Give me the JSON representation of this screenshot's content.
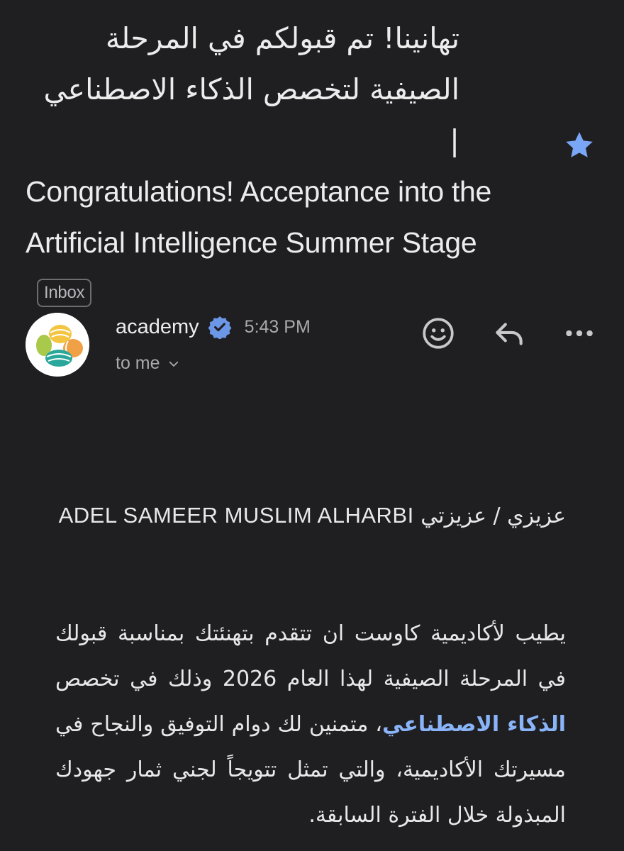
{
  "email": {
    "subject_ar": "تهانينا! تم قبولكم في المرحلة الصيفية لتخصص الذكاء الاصطناعي |",
    "subject_en": "Congratulations! Acceptance into the Artificial Intelligence Summer Stage",
    "label": "Inbox",
    "starred": true,
    "sender_name": "academy",
    "time": "5:43 PM",
    "recipient": "to me"
  },
  "body": {
    "greeting_prefix": "عزيزي / عزيزتي",
    "greeting_name": "ADEL SAMEER MUSLIM ALHARBI",
    "para_part1": "يطيب لأكاديمية كاوست ان تتقدم بتهنئتك بمناسبة قبولك في المرحلة الصيفية لهذا العام 2026 وذلك في تخصص ",
    "para_highlight": "الذكاء الاصطناعي",
    "para_part2": "، متمنين لك دوام التوفيق والنجاح في مسيرتك الأكاديمية، والتي تمثل تتويجاً لجني ثمار جهودك المبذولة خلال الفترة السابقة."
  },
  "colors": {
    "background": "#1f1f22",
    "accent_link": "#8ab4f8",
    "star": "#7aa7f5",
    "verified": "#6c97e6"
  },
  "icons": [
    "star-icon",
    "verified-icon",
    "chevron-down-icon",
    "emoji-icon",
    "reply-icon",
    "more-options-icon"
  ]
}
